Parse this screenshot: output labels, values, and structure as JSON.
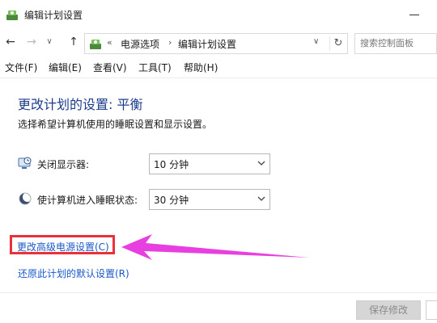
{
  "window": {
    "title": "编辑计划设置"
  },
  "address_bar": {
    "overflow_chevron": "«",
    "crumbs": [
      "电源选项",
      "编辑计划设置"
    ],
    "separator": "›",
    "dropdown": "∨",
    "refresh": "↻"
  },
  "search": {
    "placeholder": "搜索控制面板"
  },
  "nav": {
    "back": "←",
    "forward": "→",
    "recent": "∨",
    "up": "↑"
  },
  "menu": {
    "items": [
      "文件(F)",
      "编辑(E)",
      "查看(V)",
      "工具(T)",
      "帮助(H)"
    ]
  },
  "main": {
    "heading": "更改计划的设置: 平衡",
    "subtitle": "选择希望计算机使用的睡眠设置和显示设置。",
    "settings": [
      {
        "label": "关闭显示器:",
        "value": "10 分钟",
        "icon": "monitor-clock-icon"
      },
      {
        "label": "使计算机进入睡眠状态:",
        "value": "30 分钟",
        "icon": "moon-sleep-icon"
      }
    ],
    "links": {
      "advanced": "更改高级电源设置(C)",
      "restore": "还原此计划的默认设置(R)"
    }
  },
  "footer": {
    "save_label": "保存修改"
  },
  "colors": {
    "heading": "#1e3c8c",
    "link": "#1a58c8",
    "highlight_box": "#e8313a",
    "annotation_arrow": "#e840e0"
  }
}
